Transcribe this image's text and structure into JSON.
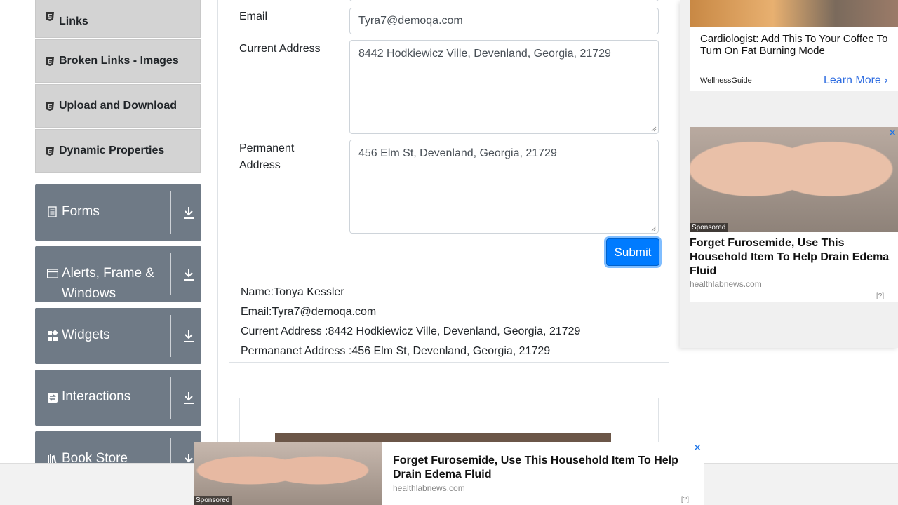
{
  "sidebar": {
    "elements_sub": [
      {
        "label": "Links"
      },
      {
        "label": "Broken Links - Images"
      },
      {
        "label": "Upload and Download"
      },
      {
        "label": "Dynamic Properties"
      }
    ],
    "groups": [
      {
        "label": "Forms",
        "icon": "form-icon"
      },
      {
        "label": "Alerts, Frame & Windows",
        "icon": "window-icon"
      },
      {
        "label": "Widgets",
        "icon": "widgets-icon"
      },
      {
        "label": "Interactions",
        "icon": "interactions-icon"
      },
      {
        "label": "Book Store",
        "icon": "books-icon"
      }
    ]
  },
  "form": {
    "email_label": "Email",
    "email_value": "Tyra7@demoqa.com",
    "current_address_label": "Current Address",
    "current_address_value": "8442 Hodkiewicz Ville, Devenland, Georgia, 21729",
    "permanent_address_label_1": "Permanent",
    "permanent_address_label_2": "Address",
    "permanent_address_value": "456 Elm St, Devenland, Georgia, 21729",
    "submit_label": "Submit"
  },
  "output": {
    "name": "Name:Tonya Kessler",
    "email": "Email:Tyra7@demoqa.com",
    "current": "Current Address :8442 Hodkiewicz Ville, Devenland, Georgia, 21729",
    "permanent": "Permananet Address :456 Elm St, Devenland, Georgia, 21729"
  },
  "ads": {
    "top_title": "Cardiologist: Add This To Your Coffee To Turn On Fat Burning Mode",
    "top_source": "WellnessGuide",
    "top_cta": "Learn More",
    "side_title": "Forget Furosemide, Use This Household Item To Help Drain Edema Fluid",
    "side_source": "healthlabnews.com",
    "sponsored": "Sponsored",
    "help": "[?]",
    "bottom_title": "Forget Furosemide, Use This Household Item To Help Drain Edema Fluid",
    "bottom_source": "healthlabnews.com"
  },
  "colors": {
    "primary": "#007bff",
    "group_bg": "#6f7a86",
    "sub_bg": "#d3d3d3"
  }
}
